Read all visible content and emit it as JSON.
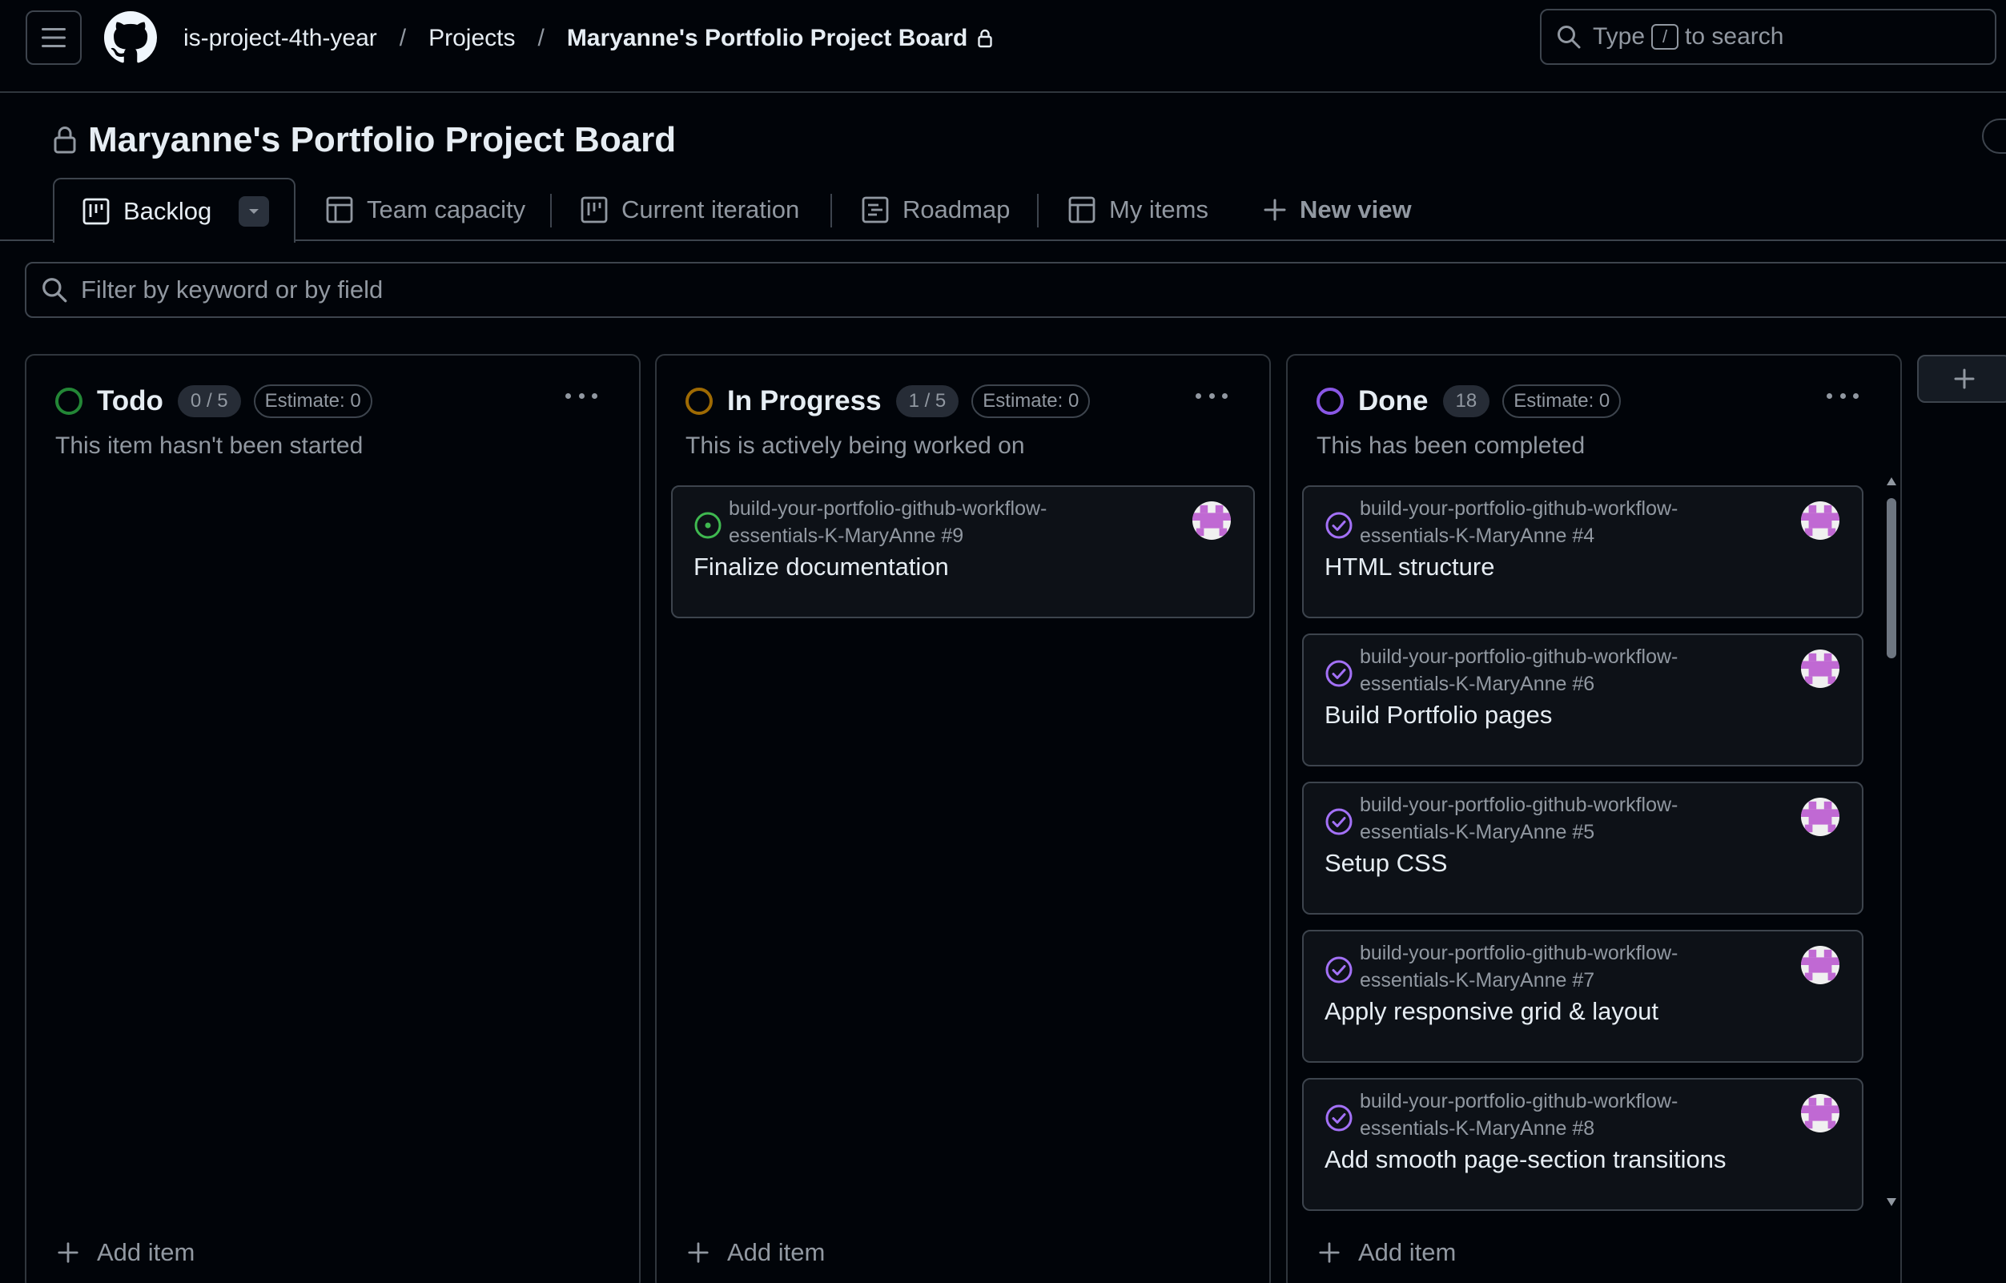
{
  "header": {
    "breadcrumbs": [
      "is-project-4th-year",
      "Projects",
      "Maryanne's Portfolio Project Board"
    ],
    "search_prefix": "Type",
    "search_key": "/",
    "search_suffix": "to search"
  },
  "project": {
    "title": "Maryanne's Portfolio Project Board"
  },
  "tabs": [
    {
      "label": "Backlog",
      "icon": "board-icon",
      "active": true
    },
    {
      "label": "Team capacity",
      "icon": "table-icon"
    },
    {
      "label": "Current iteration",
      "icon": "board-icon"
    },
    {
      "label": "Roadmap",
      "icon": "roadmap-icon"
    },
    {
      "label": "My items",
      "icon": "table-icon"
    },
    {
      "label": "New view",
      "icon": "plus-icon"
    }
  ],
  "filter": {
    "placeholder": "Filter by keyword or by field"
  },
  "columns": [
    {
      "name": "Todo",
      "count": "0 / 5",
      "estimate": "Estimate: 0",
      "description": "This item hasn't been started",
      "color": "#238636",
      "add_label": "Add item",
      "cards": []
    },
    {
      "name": "In Progress",
      "count": "1 / 5",
      "estimate": "Estimate: 0",
      "description": "This is actively being worked on",
      "color": "#9e6a03",
      "add_label": "Add item",
      "cards": [
        {
          "repo_line1": "build-your-portfolio-github-workflow-",
          "repo_line2": "essentials-K-MaryAnne #9",
          "title": "Finalize documentation",
          "state": "open-issue"
        }
      ]
    },
    {
      "name": "Done",
      "count": "18",
      "estimate": "Estimate: 0",
      "description": "This has been completed",
      "color": "#8957e5",
      "add_label": "Add item",
      "cards": [
        {
          "repo_line1": "build-your-portfolio-github-workflow-",
          "repo_line2": "essentials-K-MaryAnne #4",
          "title": "HTML structure",
          "state": "completed-issue"
        },
        {
          "repo_line1": "build-your-portfolio-github-workflow-",
          "repo_line2": "essentials-K-MaryAnne #6",
          "title": "Build Portfolio pages",
          "state": "completed-issue"
        },
        {
          "repo_line1": "build-your-portfolio-github-workflow-",
          "repo_line2": "essentials-K-MaryAnne #5",
          "title": "Setup CSS",
          "state": "completed-issue"
        },
        {
          "repo_line1": "build-your-portfolio-github-workflow-",
          "repo_line2": "essentials-K-MaryAnne #7",
          "title": "Apply responsive grid & layout",
          "state": "completed-issue"
        },
        {
          "repo_line1": "build-your-portfolio-github-workflow-",
          "repo_line2": "essentials-K-MaryAnne #8",
          "title": "Add smooth page-section transitions",
          "state": "completed-issue"
        }
      ]
    }
  ],
  "colors": {
    "open": "#3fb950",
    "done": "#a371f7",
    "avatar": "#c069d3"
  }
}
